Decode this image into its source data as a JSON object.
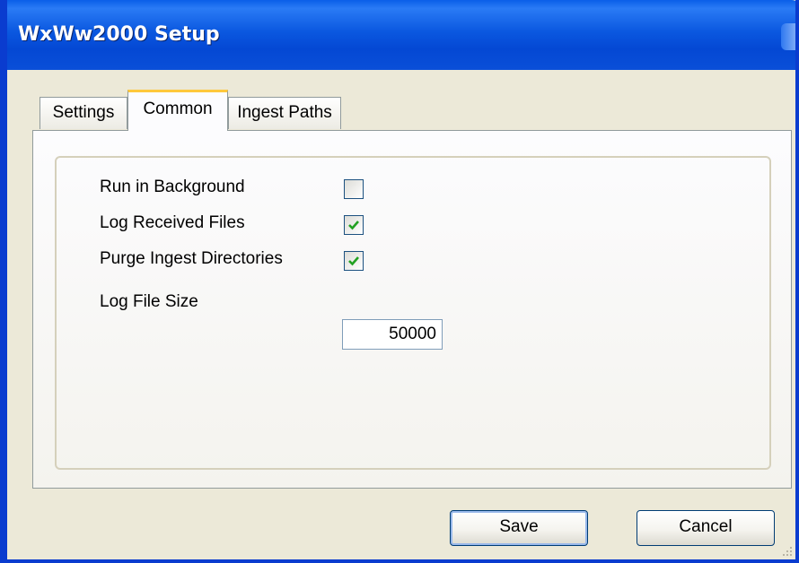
{
  "window": {
    "title": "WxWw2000 Setup"
  },
  "tabs": [
    {
      "label": "Settings",
      "active": false
    },
    {
      "label": "Common",
      "active": true
    },
    {
      "label": "Ingest Paths",
      "active": false
    }
  ],
  "common": {
    "rows": [
      {
        "label": "Run in Background",
        "checked": false
      },
      {
        "label": "Log Received Files",
        "checked": true
      },
      {
        "label": "Purge Ingest Directories",
        "checked": true
      }
    ],
    "log_file_size": {
      "label": "Log File Size",
      "value": "50000"
    }
  },
  "buttons": {
    "save": "Save",
    "cancel": "Cancel"
  },
  "colors": {
    "titlebar": "#0a5fe8",
    "active_tab_accent": "#ffc83c",
    "check_mark": "#21a121"
  },
  "icons": {
    "checkbox_checked": "check-mark-icon",
    "resize_grip": "resize-grip-icon"
  }
}
